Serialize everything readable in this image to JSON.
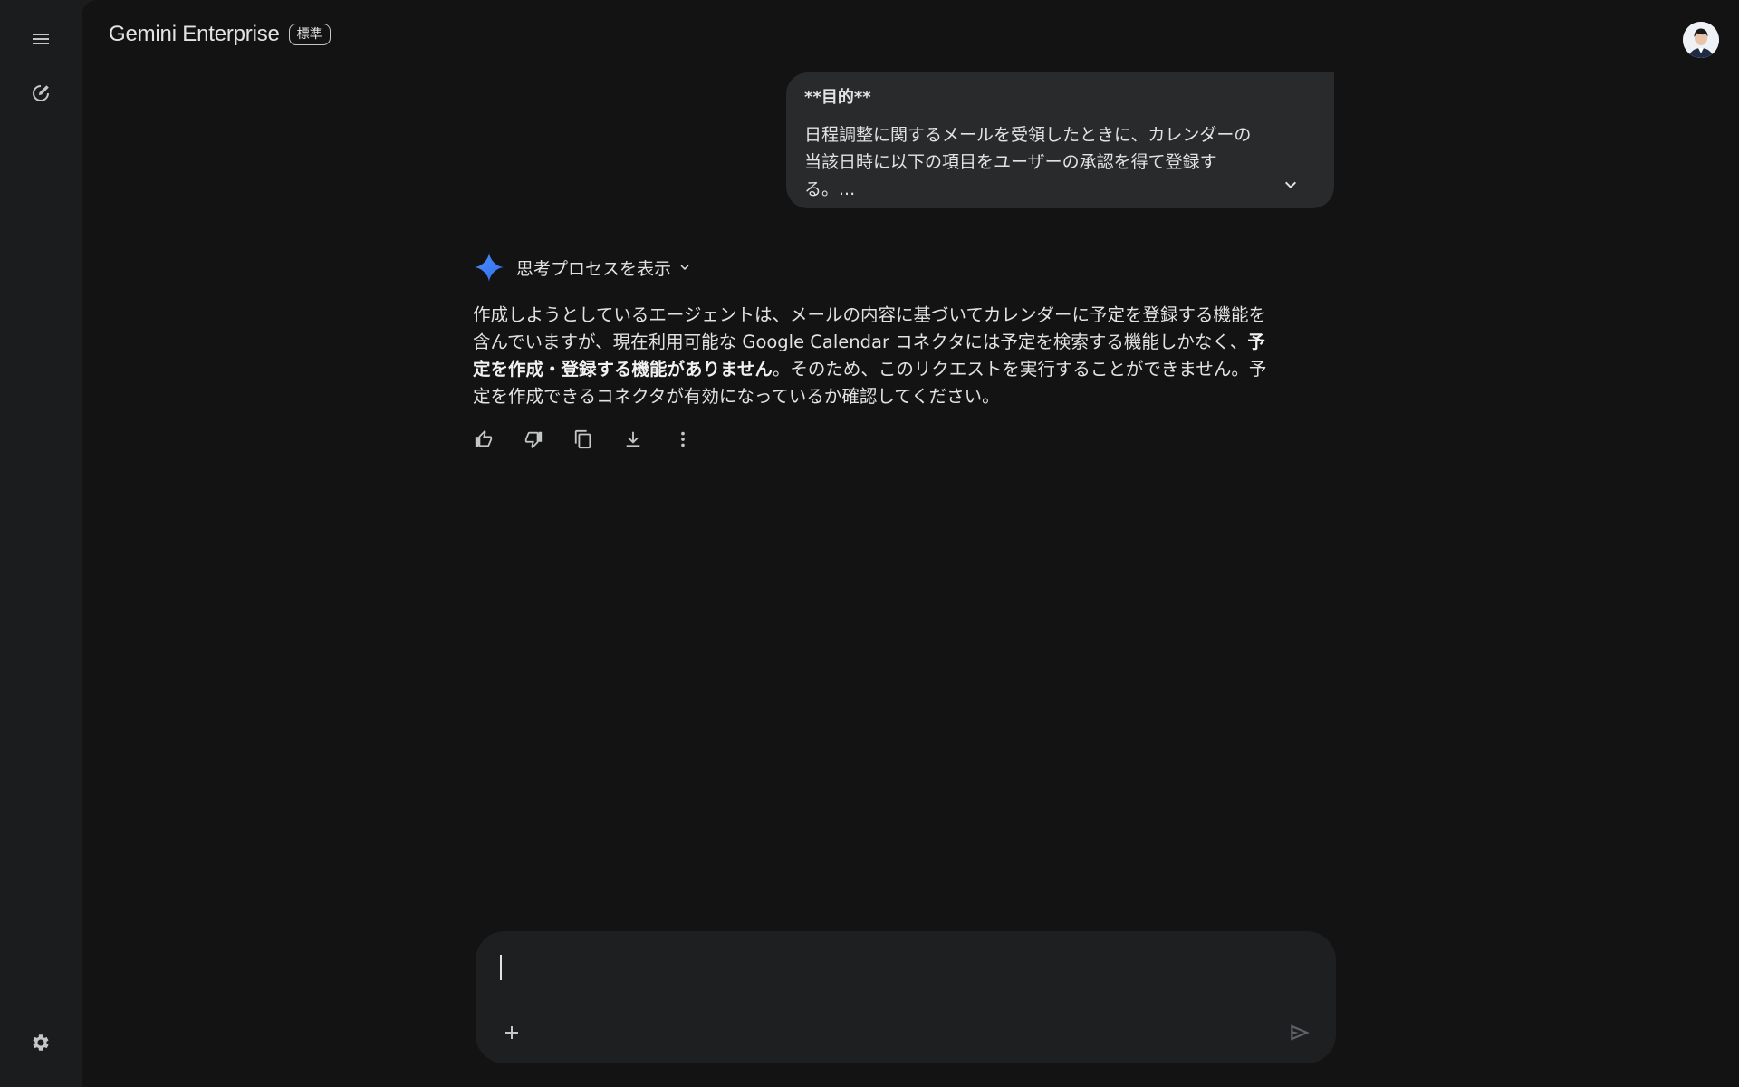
{
  "app": {
    "brand": "Gemini Enterprise",
    "edition_badge": "標準"
  },
  "icons": {
    "menu": "menu-icon",
    "new_chat": "edit-icon",
    "settings": "gear-icon",
    "avatar": "user-avatar",
    "expand": "chevron-down-icon",
    "sparkle": "gemini-sparkle-icon",
    "thumb_up": "thumb-up-icon",
    "thumb_down": "thumb-down-icon",
    "copy": "copy-icon",
    "download": "download-icon",
    "more": "more-vert-icon",
    "add": "plus-icon",
    "send": "send-icon"
  },
  "user_message": {
    "heading": "**目的**",
    "body": "日程調整に関するメールを受領したときに、カレンダーの当該日時に以下の項目をユーザーの承認を得て登録する。..."
  },
  "response": {
    "thinking_toggle": "思考プロセスを表示",
    "text_part1": "作成しようとしているエージェントは、メールの内容に基づいてカレンダーに予定を登録する機能を含んでいますが、現在利用可能な Google Calendar コネクタには予定を検索する機能しかなく、",
    "text_bold": "予定を作成・登録する機能がありません",
    "text_part2": "。そのため、このリクエストを実行することができません。予定を作成できるコネクタが有効になっているか確認してください。"
  },
  "composer": {
    "value": "",
    "placeholder": ""
  },
  "colors": {
    "rail_bg": "#1b1c1d",
    "main_bg": "#131314",
    "bubble_bg": "#282a2c",
    "composer_bg": "#1e1f20",
    "text": "#e3e3e3",
    "sparkle_blue": "#4285f4"
  }
}
